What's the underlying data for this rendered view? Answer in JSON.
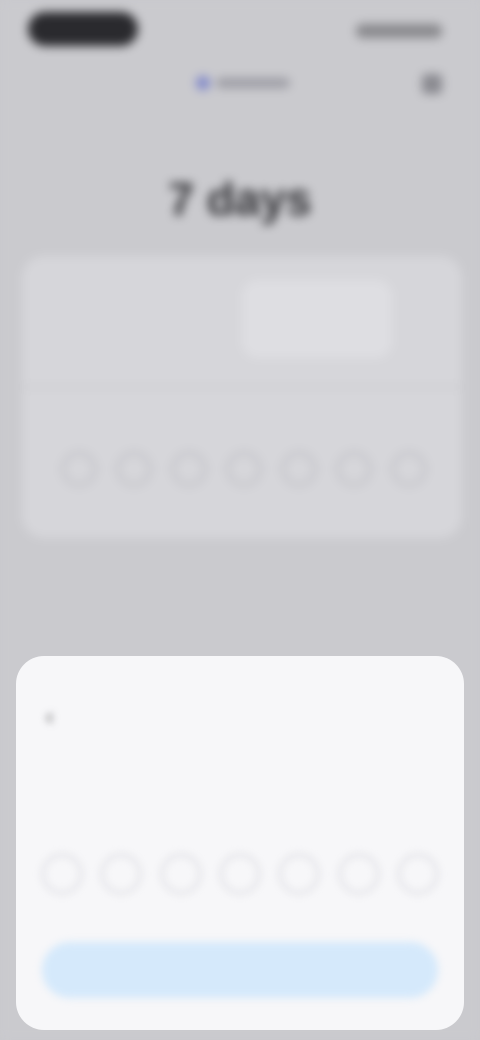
{
  "background": {
    "title": "7 days",
    "card": {
      "heading": "",
      "subtitle": "",
      "days_label": ""
    },
    "section_label": ""
  },
  "sheet": {
    "back_icon": "chevron-left-icon",
    "title": "",
    "description": "",
    "days_label": "",
    "days": [
      "",
      "",
      "",
      "",
      "",
      "",
      ""
    ],
    "primary_button": ""
  },
  "colors": {
    "sheet_background": "#f7f7f9",
    "button_background": "#d5e9fb",
    "dimmed_background": "#cacace"
  }
}
